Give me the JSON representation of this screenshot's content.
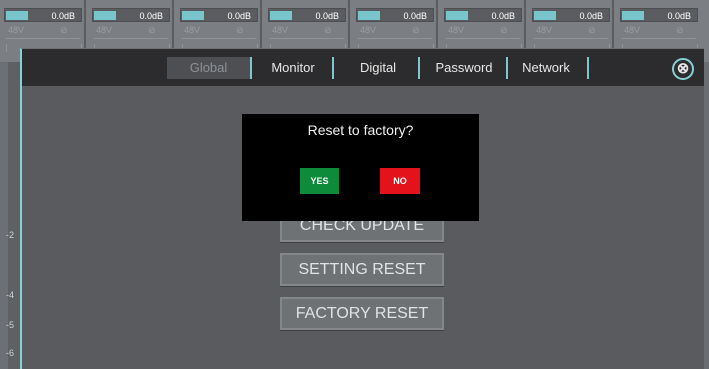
{
  "channels": [
    {
      "gain": "0.0dB",
      "p48": "48V",
      "phase": "⊘"
    },
    {
      "gain": "0.0dB",
      "p48": "48V",
      "phase": "⊘"
    },
    {
      "gain": "0.0dB",
      "p48": "48V",
      "phase": "⊘"
    },
    {
      "gain": "0.0dB",
      "p48": "48V",
      "phase": "⊘"
    },
    {
      "gain": "0.0dB",
      "p48": "48V",
      "phase": "⊘"
    },
    {
      "gain": "0.0dB",
      "p48": "48V",
      "phase": "⊘"
    },
    {
      "gain": "0.0dB",
      "p48": "48V",
      "phase": "⊘"
    },
    {
      "gain": "0.0dB",
      "p48": "48V",
      "phase": "⊘"
    }
  ],
  "scale_labels": [
    "-2",
    "-4",
    "-5",
    "-6"
  ],
  "tabs": [
    "Global",
    "Monitor",
    "Digital",
    "Password",
    "Network"
  ],
  "active_tab": "Global",
  "close_icon": "⊗",
  "actions": {
    "check_update": "CHECK UPDATE",
    "setting_reset": "SETTING RESET",
    "factory_reset": "FACTORY RESET"
  },
  "dialog": {
    "title": "Reset to factory?",
    "yes": "YES",
    "no": "NO"
  },
  "colors": {
    "accent": "#86d0d6",
    "yes": "#0e8a3b",
    "no": "#e3121b"
  }
}
